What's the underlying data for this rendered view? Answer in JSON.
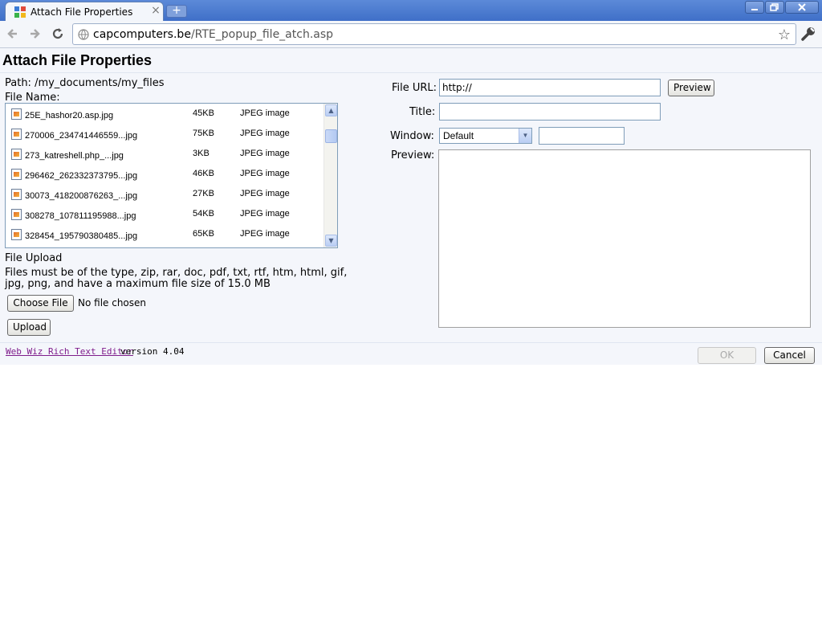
{
  "browser": {
    "tab_title": "Attach File Properties",
    "tab_close": "×",
    "new_tab": "+",
    "url_host": "capcomputers.be",
    "url_path": "/RTE_popup_file_atch.asp"
  },
  "page": {
    "title": "Attach File Properties",
    "path_label": "Path: /my_documents/my_files",
    "file_name_label": "File Name:",
    "files": [
      {
        "name": "25E_hashor20.asp.jpg",
        "size": "45KB",
        "type": "JPEG image"
      },
      {
        "name": "270006_234741446559...jpg",
        "size": "75KB",
        "type": "JPEG image"
      },
      {
        "name": "273_katreshell.php_...jpg",
        "size": "3KB",
        "type": "JPEG image"
      },
      {
        "name": "296462_262332373795...jpg",
        "size": "46KB",
        "type": "JPEG image"
      },
      {
        "name": "30073_418200876263_...jpg",
        "size": "27KB",
        "type": "JPEG image"
      },
      {
        "name": "308278_107811195988...jpg",
        "size": "54KB",
        "type": "JPEG image"
      },
      {
        "name": "328454_195790380485...jpg",
        "size": "65KB",
        "type": "JPEG image"
      }
    ],
    "upload": {
      "heading": "File Upload",
      "note_line1": "Files must be of the type, zip, rar, doc, pdf, txt, rtf, htm, html, gif,",
      "note_line2": "jpg, png, and have a maximum file size of 15.0 MB",
      "choose_button": "Choose File",
      "no_file": "No file chosen",
      "upload_button": "Upload"
    },
    "form": {
      "file_url_label": "File URL:",
      "file_url_value": "http://",
      "preview_button": "Preview",
      "title_label": "Title:",
      "title_value": "",
      "window_label": "Window:",
      "window_selected": "Default",
      "window_target_value": "",
      "preview_label": "Preview:"
    },
    "footer": {
      "link_text": "Web Wiz Rich Text Editor",
      "version_text": "version 4.04",
      "ok_button": "OK",
      "cancel_button": "Cancel"
    }
  }
}
